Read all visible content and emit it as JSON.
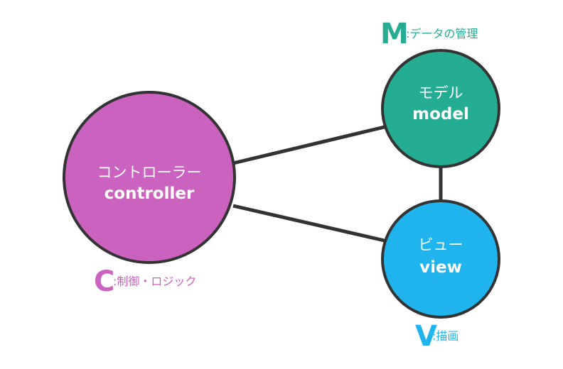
{
  "colors": {
    "controller": "#cb62bf",
    "model": "#24ad92",
    "view": "#20b4ee",
    "outline": "#333333"
  },
  "nodes": {
    "controller": {
      "label_jp": "コントローラー",
      "label_en": "controller"
    },
    "model": {
      "label_jp": "モデル",
      "label_en": "model"
    },
    "view": {
      "label_jp": "ビュー",
      "label_en": "view"
    }
  },
  "captions": {
    "model": {
      "letter": "M",
      "text": ":データの管理"
    },
    "controller": {
      "letter": "C",
      "text": ":制御・ロジック"
    },
    "view": {
      "letter": "V",
      "text": ":描画"
    }
  }
}
